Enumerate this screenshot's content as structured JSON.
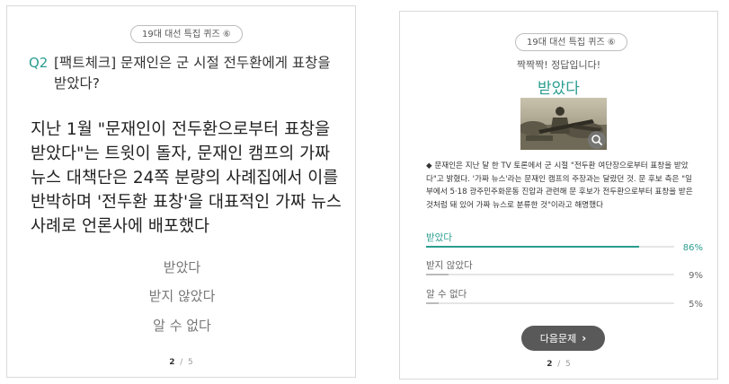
{
  "left": {
    "badge": "19대 대선 특집 퀴즈 ⑥",
    "question_number": "Q2",
    "question_title": "[팩트체크] 문재인은 군 시절 전두환에게 표창을 받았다?",
    "question_body": "지난 1월 \"문재인이 전두환으로부터 표창을 받았다\"는 트윗이 돌자, 문재인 캠프의 가짜 뉴스 대책단은 24쪽 분량의 사례집에서 이를 반박하며 '전두환 표창'을 대표적인 가짜 뉴스 사례로 언론사에 배포했다",
    "options": [
      "받았다",
      "받지 않았다",
      "알 수 없다"
    ],
    "pager": {
      "current": "2",
      "separator": "/",
      "total": "5"
    }
  },
  "right": {
    "badge": "19대 대선 특집 퀴즈 ⑥",
    "correct_message": "짝짝짝! 정답입니다!",
    "answer": "받았다",
    "explanation": "◆ 문재인은 지난 달 한 TV 토론에서 군 시절 \"전두환 여단장으로부터 표창을 받았다\"고 밝혔다. '가짜 뉴스'라는 문재인 캠프의 주장과는 달랐던 것. 문 후보 측은 \"일부에서 5·18 광주민주화운동 진압과 관련해 문 후보가 전두환으로부터 표창을 받은 것처럼 돼 있어 가짜 뉴스로 분류한 것\"이라고 해명했다",
    "results": [
      {
        "label": "받았다",
        "percent": 86,
        "display": "86%",
        "winner": true
      },
      {
        "label": "받지 않았다",
        "percent": 9,
        "display": "9%",
        "winner": false
      },
      {
        "label": "알 수 없다",
        "percent": 5,
        "display": "5%",
        "winner": false
      }
    ],
    "next_button": "다음문제",
    "pager": {
      "current": "2",
      "separator": "/",
      "total": "5"
    }
  },
  "colors": {
    "accent": "#2a9d8f",
    "button": "#595959"
  },
  "icons": {
    "zoom": "magnifier-icon",
    "next": "chevron-right-icon"
  }
}
